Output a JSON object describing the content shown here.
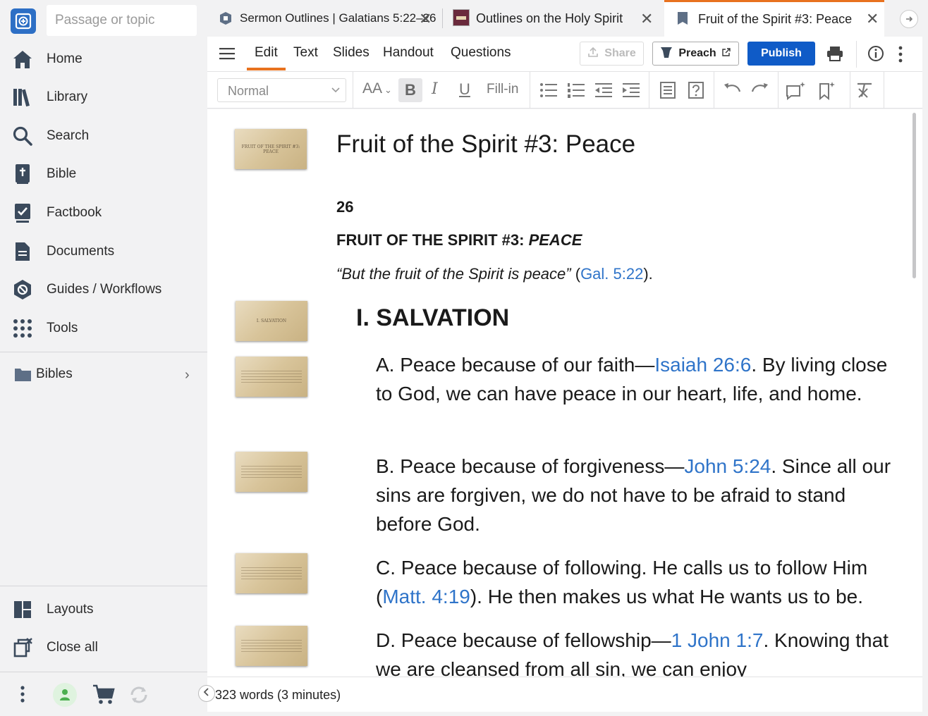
{
  "sidebar": {
    "search_placeholder": "Passage or topic",
    "items": [
      {
        "label": "Home",
        "icon": "home-icon"
      },
      {
        "label": "Library",
        "icon": "library-icon"
      },
      {
        "label": "Search",
        "icon": "search-icon"
      },
      {
        "label": "Bible",
        "icon": "bible-icon"
      },
      {
        "label": "Factbook",
        "icon": "factbook-icon"
      },
      {
        "label": "Documents",
        "icon": "documents-icon"
      },
      {
        "label": "Guides / Workflows",
        "icon": "guides-icon"
      },
      {
        "label": "Tools",
        "icon": "tools-icon"
      }
    ],
    "bibles_label": "Bibles",
    "layouts_label": "Layouts",
    "close_all_label": "Close all"
  },
  "tabs": [
    {
      "label": "Sermon Outlines | Galatians 5:22–26"
    },
    {
      "label": "Outlines on the Holy Spirit"
    },
    {
      "label": "Fruit of the Spirit #3: Peace"
    }
  ],
  "toolbar": {
    "menus": [
      "Edit",
      "Text",
      "Slides",
      "Handout",
      "Questions"
    ],
    "share_label": "Share",
    "preach_label": "Preach",
    "publish_label": "Publish",
    "style_select": "Normal",
    "fill_in_label": "Fill-in",
    "font_size_glyph": "AA",
    "bold_glyph": "B",
    "italic_glyph": "I",
    "underline_glyph": "U"
  },
  "document": {
    "title": "Fruit of the Spirit #3: Peace",
    "number": "26",
    "heading_prefix": "FRUIT OF THE SPIRIT #3: ",
    "heading_emph": "PEACE",
    "quote_text": "“But the fruit of the Spirit is peace”",
    "quote_open": " (",
    "quote_ref": "Gal. 5:22",
    "quote_close": ").",
    "section_heading": "I. SALVATION",
    "points": [
      {
        "prefix": "A. Peace because of our faith—",
        "ref": "Isaiah 26:6",
        "suffix": ". By living close to God, we can have peace in our heart, life, and home."
      },
      {
        "prefix": "B. Peace because of forgiveness—",
        "ref": "John 5:24",
        "suffix": ". Since all our sins are forgiven, we do not have to be afraid to stand before God."
      },
      {
        "prefix": "C. Peace because of following. He calls us to follow Him (",
        "ref": "Matt. 4:19",
        "suffix": "). He then makes us what He wants us to be."
      },
      {
        "prefix": "D. Peace because of fellowship—",
        "ref": "1 John 1:7",
        "suffix": ". Knowing that we are cleansed from all sin, we can enjoy"
      }
    ],
    "slide_thumbs": [
      "FRUIT OF THE SPIRIT #3: PEACE",
      "I. SALVATION"
    ]
  },
  "status": {
    "word_count": "323 words (3 minutes)"
  },
  "colors": {
    "accent_tab": "#e8721f",
    "publish": "#0f5bc7",
    "link": "#2f74c9"
  }
}
